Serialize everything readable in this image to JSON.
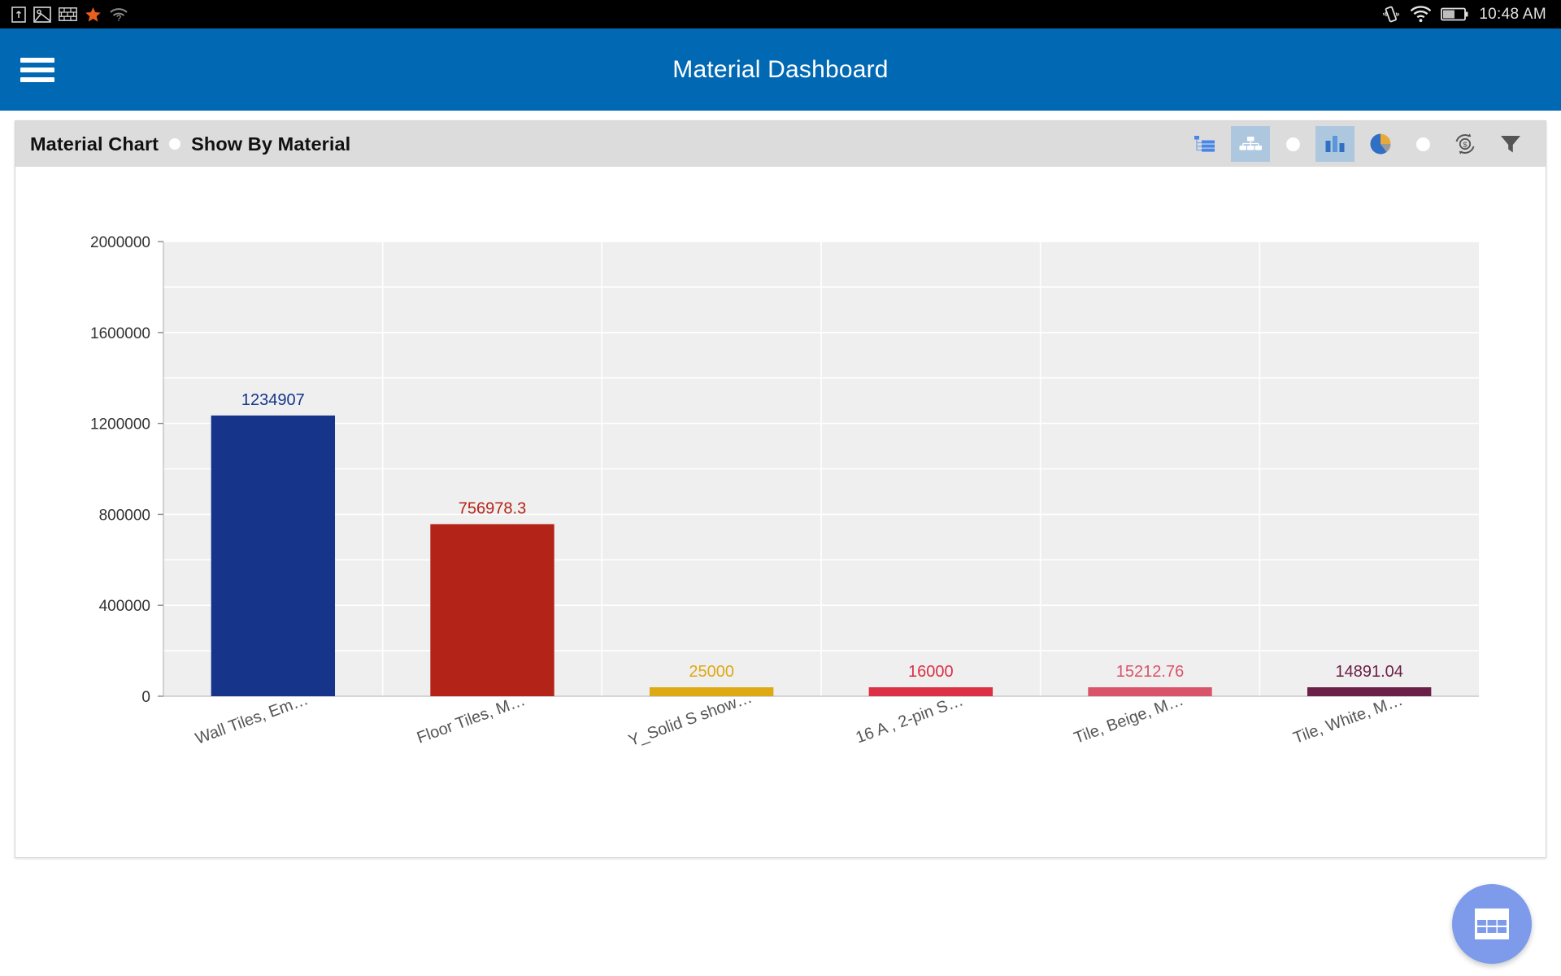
{
  "status_bar": {
    "icons": [
      "sim-card-icon",
      "image-icon",
      "firewall-icon",
      "star-icon",
      "wifi-question-icon"
    ],
    "right_icons": [
      "vibrate-icon",
      "wifi-icon",
      "battery-icon"
    ],
    "time": "10:48 AM"
  },
  "app_bar": {
    "menu_icon": "hamburger-menu-icon",
    "title": "Material Dashboard"
  },
  "card": {
    "title": "Material Chart",
    "separator": "dot-separator",
    "subtitle": "Show By Material",
    "toolbar": [
      {
        "name": "tree-list-icon",
        "label": "Tree List View",
        "active": false
      },
      {
        "name": "hierarchy-icon",
        "label": "Hierarchy View",
        "active": true
      },
      {
        "name": "dot-separator-1",
        "label": "",
        "active": false
      },
      {
        "name": "bar-chart-icon",
        "label": "Bar Chart",
        "active": true
      },
      {
        "name": "pie-chart-icon",
        "label": "Pie Chart",
        "active": false
      },
      {
        "name": "dot-separator-2",
        "label": "",
        "active": false
      },
      {
        "name": "currency-refresh-icon",
        "label": "Currency Refresh",
        "active": false
      },
      {
        "name": "filter-funnel-icon",
        "label": "Filter",
        "active": false
      }
    ]
  },
  "fab": {
    "icon": "table-grid-icon",
    "color": "#7d9bea"
  },
  "chart_data": {
    "type": "bar",
    "title": "Material Chart",
    "xlabel": "",
    "ylabel": "",
    "ylim": [
      0,
      2000000
    ],
    "yticks": [
      0,
      400000,
      800000,
      1200000,
      1600000,
      2000000
    ],
    "ytick_labels": [
      "0",
      "400000",
      "800000",
      "1200000",
      "1600000",
      "2000000"
    ],
    "grid": true,
    "legend": false,
    "plot_bg": "#efefef",
    "categories": [
      "Wall Tiles, Em…",
      "Floor Tiles, M…",
      "Y_Solid S show…",
      "16 A , 2-pin S…",
      "Tile, Beige, M…",
      "Tile, White, M…"
    ],
    "values": [
      1234907,
      756978.3,
      25000,
      16000,
      15212.76,
      14891.04
    ],
    "value_labels": [
      "1234907",
      "756978.3",
      "25000",
      "16000",
      "15212.76",
      "14891.04"
    ],
    "colors": [
      "#15348A",
      "#B42318",
      "#DDA914",
      "#DB3046",
      "#D9546A",
      "#6B2047"
    ]
  }
}
